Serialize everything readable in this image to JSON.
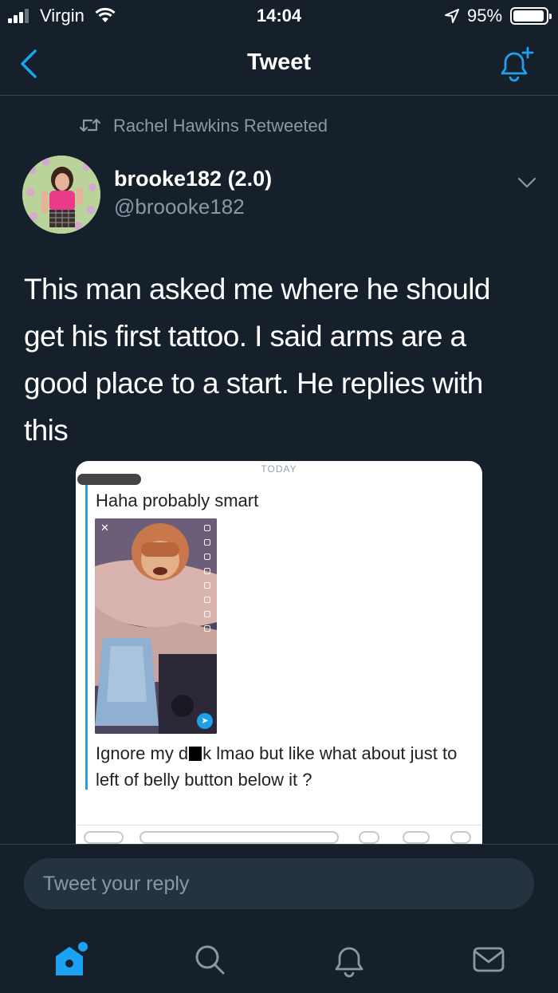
{
  "status_bar": {
    "carrier": "Virgin",
    "time": "14:04",
    "battery_percent": "95%",
    "battery_level": 0.95,
    "icons": [
      "signal-icon",
      "wifi-icon",
      "location-arrow-icon",
      "battery-icon"
    ]
  },
  "header": {
    "title": "Tweet",
    "back_icon": "chevron-left-icon",
    "action_icon": "bell-plus-icon",
    "accent_color": "#1da1f2"
  },
  "retweet": {
    "text": "Rachel Hawkins Retweeted",
    "icon": "retweet-icon"
  },
  "tweet": {
    "author_name": "brooke182 (2.0)",
    "author_handle": "@broooke182",
    "text": "This man asked me where he should get his first tattoo. I said arms are a good place to a start. He replies with this",
    "menu_icon": "chevron-down-icon"
  },
  "media": {
    "date_label": "TODAY",
    "message_1": "Haha probably smart",
    "message_2_before": "Ignore my d",
    "message_2_after": "k lmao but like what about just to left of belly button below it ?"
  },
  "reply": {
    "placeholder": "Tweet your reply"
  },
  "tabbar": {
    "items": [
      "home-icon",
      "search-icon",
      "notifications-icon",
      "messages-icon"
    ],
    "active": "home-icon"
  }
}
